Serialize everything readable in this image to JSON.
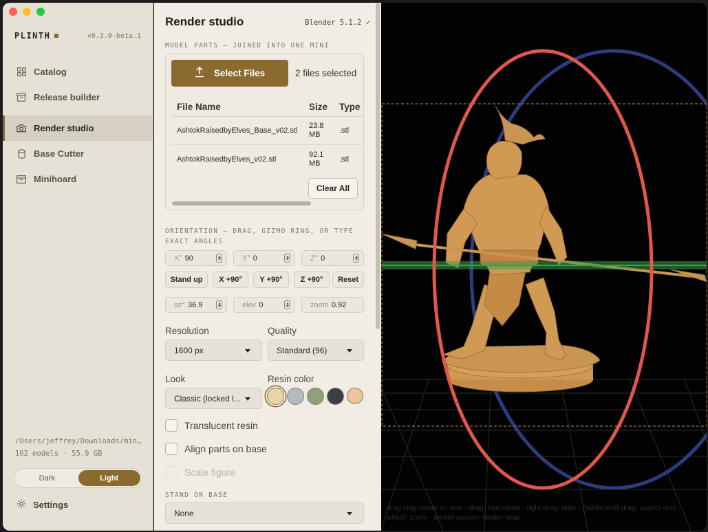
{
  "sidebar": {
    "brand": "PLINTH",
    "version": "v0.3.0-beta.1",
    "nav": [
      {
        "label": "Catalog",
        "icon": "grid-icon"
      },
      {
        "label": "Release builder",
        "icon": "archive-icon"
      },
      {
        "label": "Render studio",
        "icon": "camera-icon",
        "active": true
      },
      {
        "label": "Base Cutter",
        "icon": "cylinder-icon"
      },
      {
        "label": "Minihoard",
        "icon": "box-icon"
      }
    ],
    "library_path": "/Users/jeffrey/Downloads/min…",
    "library_stats": "162 models · 55.9 GB",
    "theme": {
      "dark": "Dark",
      "light": "Light",
      "selected": "Light"
    },
    "settings_label": "Settings"
  },
  "main": {
    "title": "Render studio",
    "blender_status": "Blender 5.1.2 ✓",
    "model_parts_heading": "MODEL PARTS — JOINED INTO ONE MINI",
    "select_files_label": "Select Files",
    "files_selected": "2 files selected",
    "file_table": {
      "headers": [
        "File Name",
        "Size",
        "Type"
      ],
      "rows": [
        {
          "name": "AshtokRaisedbyElves_Base_v02.stl",
          "size": "23.8 MB",
          "type": ".stl"
        },
        {
          "name": "AshtokRaisedbyElves_v02.stl",
          "size": "92.1 MB",
          "type": ".stl"
        }
      ]
    },
    "clear_all_label": "Clear All",
    "orientation_heading": "ORIENTATION — DRAG, GIZMO RING, OR TYPE EXACT ANGLES",
    "angles": {
      "x_label": "X°",
      "x": "90",
      "y_label": "Y°",
      "y": "0",
      "z_label": "Z°",
      "z": "0"
    },
    "angle_buttons": [
      "Stand up",
      "X +90°",
      "Y +90°",
      "Z +90°",
      "Reset"
    ],
    "camera": {
      "az_label": "az°",
      "az": "36.9",
      "elev_label": "elev",
      "elev": "0",
      "zoom_label": "zoom",
      "zoom": "0.92"
    },
    "resolution_label": "Resolution",
    "resolution_value": "1600 px",
    "quality_label": "Quality",
    "quality_value": "Standard (96)",
    "look_label": "Look",
    "look_value": "Classic (locked l...",
    "resin_label": "Resin color",
    "resin_colors": [
      "#ecd2a8",
      "#b5b9c2",
      "#8fa07a",
      "#3d3e43",
      "#ebc799"
    ],
    "resin_selected_index": 0,
    "options": [
      {
        "label": "Translucent resin",
        "checked": false,
        "disabled": false
      },
      {
        "label": "Align parts on base",
        "checked": false,
        "disabled": false
      },
      {
        "label": "Scale figure",
        "checked": false,
        "disabled": true
      }
    ],
    "stand_heading": "STAND ON BASE",
    "stand_value": "None"
  },
  "viewport": {
    "hint": "drag ring: rotate on axis · drag: free rotate · right-drag: orbit · middle/shift-drag: aspect only · wheel: zoom · amber square: render crop",
    "model_color": "#d09a55",
    "x_ring_color": "#e0584b",
    "y_ring_color": "#2c3d7d",
    "z_ring_color": "#3aa04a",
    "crop_color": "#a0703a"
  }
}
